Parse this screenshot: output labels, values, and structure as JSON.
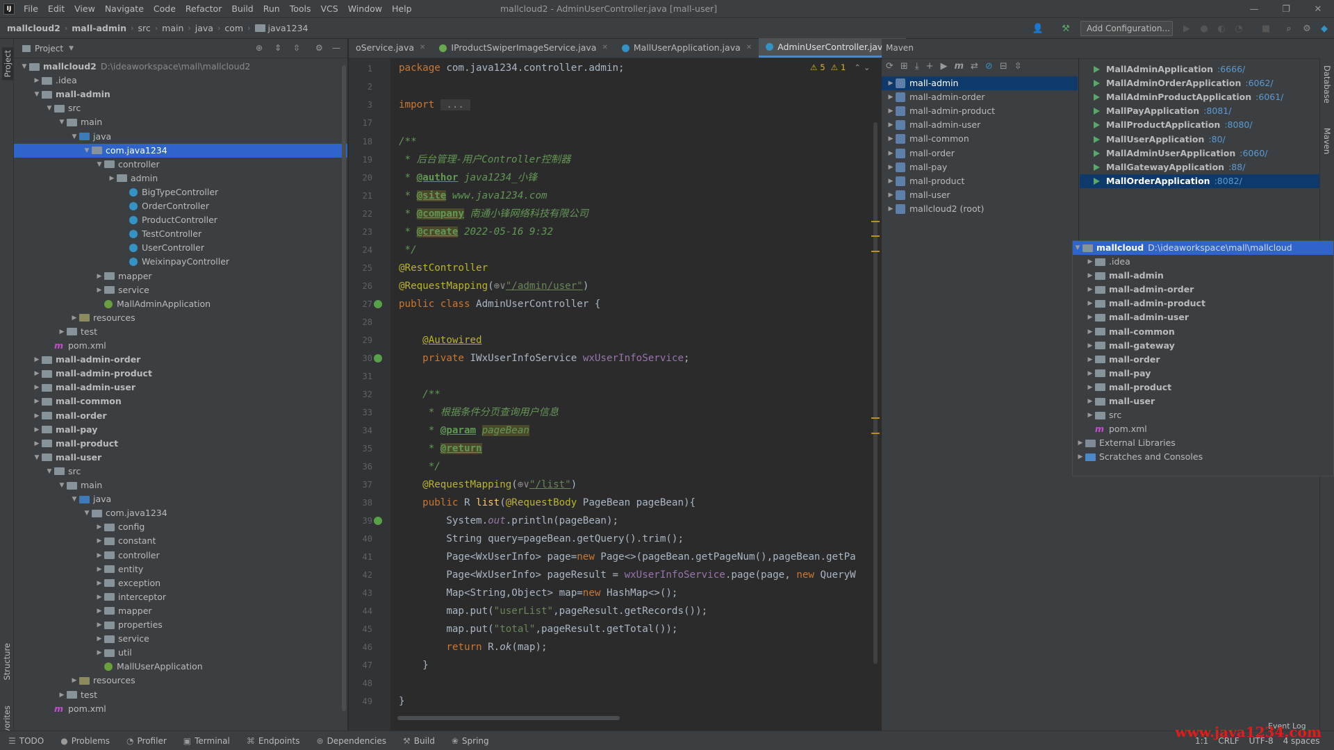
{
  "menu": {
    "items": [
      "File",
      "Edit",
      "View",
      "Navigate",
      "Code",
      "Refactor",
      "Build",
      "Run",
      "Tools",
      "VCS",
      "Window",
      "Help"
    ],
    "window_title": "mallcloud2 - AdminUserController.java [mall-user]"
  },
  "breadcrumb": [
    "mallcloud2",
    "mall-admin",
    "src",
    "main",
    "java",
    "com",
    "java1234"
  ],
  "toolbar": {
    "run_config": "Add Configuration..."
  },
  "side_labels": {
    "project": "Project",
    "structure": "Structure",
    "favorites": "Favorites",
    "database": "Database",
    "maven": "Maven"
  },
  "project": {
    "title": "Project",
    "tree": [
      {
        "label": "mallcloud2",
        "path": "D:\\ideaworkspace\\mall\\mallcloud2",
        "bold": true,
        "icon": "module",
        "indent": 0,
        "arrow": "open"
      },
      {
        "label": ".idea",
        "icon": "folder",
        "indent": 1,
        "arrow": "closed"
      },
      {
        "label": "mall-admin",
        "icon": "module",
        "indent": 1,
        "arrow": "open",
        "bold": true
      },
      {
        "label": "src",
        "icon": "folder",
        "indent": 2,
        "arrow": "open"
      },
      {
        "label": "main",
        "icon": "folder",
        "indent": 3,
        "arrow": "open"
      },
      {
        "label": "java",
        "icon": "src",
        "indent": 4,
        "arrow": "open"
      },
      {
        "label": "com.java1234",
        "icon": "folder",
        "indent": 5,
        "arrow": "open",
        "selected": true
      },
      {
        "label": "controller",
        "icon": "folder",
        "indent": 6,
        "arrow": "open"
      },
      {
        "label": "admin",
        "icon": "folder",
        "indent": 7,
        "arrow": "closed"
      },
      {
        "label": "BigTypeController",
        "icon": "class",
        "indent": 8
      },
      {
        "label": "OrderController",
        "icon": "class",
        "indent": 8
      },
      {
        "label": "ProductController",
        "icon": "class",
        "indent": 8
      },
      {
        "label": "TestController",
        "icon": "class",
        "indent": 8
      },
      {
        "label": "UserController",
        "icon": "class",
        "indent": 8
      },
      {
        "label": "WeixinpayController",
        "icon": "class",
        "indent": 8
      },
      {
        "label": "mapper",
        "icon": "folder",
        "indent": 6,
        "arrow": "closed"
      },
      {
        "label": "service",
        "icon": "folder",
        "indent": 6,
        "arrow": "closed"
      },
      {
        "label": "MallAdminApplication",
        "icon": "spring",
        "indent": 6
      },
      {
        "label": "resources",
        "icon": "res",
        "indent": 4,
        "arrow": "closed"
      },
      {
        "label": "test",
        "icon": "folder",
        "indent": 3,
        "arrow": "closed"
      },
      {
        "label": "pom.xml",
        "icon": "maven",
        "indent": 2
      },
      {
        "label": "mall-admin-order",
        "icon": "module",
        "indent": 1,
        "arrow": "closed",
        "bold": true
      },
      {
        "label": "mall-admin-product",
        "icon": "module",
        "indent": 1,
        "arrow": "closed",
        "bold": true
      },
      {
        "label": "mall-admin-user",
        "icon": "module",
        "indent": 1,
        "arrow": "closed",
        "bold": true
      },
      {
        "label": "mall-common",
        "icon": "module",
        "indent": 1,
        "arrow": "closed",
        "bold": true
      },
      {
        "label": "mall-order",
        "icon": "module",
        "indent": 1,
        "arrow": "closed",
        "bold": true
      },
      {
        "label": "mall-pay",
        "icon": "module",
        "indent": 1,
        "arrow": "closed",
        "bold": true
      },
      {
        "label": "mall-product",
        "icon": "module",
        "indent": 1,
        "arrow": "closed",
        "bold": true
      },
      {
        "label": "mall-user",
        "icon": "module",
        "indent": 1,
        "arrow": "open",
        "bold": true
      },
      {
        "label": "src",
        "icon": "folder",
        "indent": 2,
        "arrow": "open"
      },
      {
        "label": "main",
        "icon": "folder",
        "indent": 3,
        "arrow": "open"
      },
      {
        "label": "java",
        "icon": "src",
        "indent": 4,
        "arrow": "open"
      },
      {
        "label": "com.java1234",
        "icon": "folder",
        "indent": 5,
        "arrow": "open"
      },
      {
        "label": "config",
        "icon": "folder",
        "indent": 6,
        "arrow": "closed"
      },
      {
        "label": "constant",
        "icon": "folder",
        "indent": 6,
        "arrow": "closed"
      },
      {
        "label": "controller",
        "icon": "folder",
        "indent": 6,
        "arrow": "closed"
      },
      {
        "label": "entity",
        "icon": "folder",
        "indent": 6,
        "arrow": "closed"
      },
      {
        "label": "exception",
        "icon": "folder",
        "indent": 6,
        "arrow": "closed"
      },
      {
        "label": "interceptor",
        "icon": "folder",
        "indent": 6,
        "arrow": "closed"
      },
      {
        "label": "mapper",
        "icon": "folder",
        "indent": 6,
        "arrow": "closed"
      },
      {
        "label": "properties",
        "icon": "folder",
        "indent": 6,
        "arrow": "closed"
      },
      {
        "label": "service",
        "icon": "folder",
        "indent": 6,
        "arrow": "closed"
      },
      {
        "label": "util",
        "icon": "folder",
        "indent": 6,
        "arrow": "closed"
      },
      {
        "label": "MallUserApplication",
        "icon": "spring",
        "indent": 6
      },
      {
        "label": "resources",
        "icon": "res",
        "indent": 4,
        "arrow": "closed"
      },
      {
        "label": "test",
        "icon": "folder",
        "indent": 3,
        "arrow": "closed"
      },
      {
        "label": "pom.xml",
        "icon": "maven",
        "indent": 2
      }
    ]
  },
  "editor": {
    "tabs": [
      {
        "label": "oService.java",
        "active": false
      },
      {
        "label": "IProductSwiperImageService.java",
        "active": false
      },
      {
        "label": "MallUserApplication.java",
        "active": false
      },
      {
        "label": "AdminUserController.java",
        "active": true
      }
    ],
    "inspection": {
      "warnings": "5",
      "weak": "1"
    },
    "line_numbers": [
      "1",
      "2",
      "3",
      "17",
      "18",
      "19",
      "20",
      "21",
      "22",
      "23",
      "24",
      "25",
      "26",
      "27",
      "28",
      "29",
      "30",
      "31",
      "32",
      "33",
      "34",
      "35",
      "36",
      "37",
      "38",
      "39",
      "40",
      "41",
      "42",
      "43",
      "44",
      "45",
      "46",
      "47",
      "48",
      "49"
    ]
  },
  "maven": {
    "title": "Maven",
    "modules": [
      "mall-admin",
      "mall-admin-order",
      "mall-admin-product",
      "mall-admin-user",
      "mall-common",
      "mall-order",
      "mall-pay",
      "mall-product",
      "mall-user",
      "mallcloud2 (root)"
    ],
    "apps": [
      {
        "name": "MallAdminApplication",
        "port": ":6666/"
      },
      {
        "name": "MallAdminOrderApplication",
        "port": ":6062/"
      },
      {
        "name": "MallAdminProductApplication",
        "port": ":6061/"
      },
      {
        "name": "MallPayApplication",
        "port": ":8081/"
      },
      {
        "name": "MallProductApplication",
        "port": ":8080/"
      },
      {
        "name": "MallUserApplication",
        "port": ":80/"
      },
      {
        "name": "MallAdminUserApplication",
        "port": ":6060/"
      },
      {
        "name": "MallGatewayApplication",
        "port": ":88/"
      },
      {
        "name": "MallOrderApplication",
        "port": ":8082/"
      }
    ]
  },
  "popup_tree": {
    "root": "mallcloud",
    "root_path": "D:\\ideaworkspace\\mall\\mallcloud",
    "items": [
      ".idea",
      "mall-admin",
      "mall-admin-order",
      "mall-admin-product",
      "mall-admin-user",
      "mall-common",
      "mall-gateway",
      "mall-order",
      "mall-pay",
      "mall-product",
      "mall-user",
      "src",
      "pom.xml",
      "External Libraries",
      "Scratches and Consoles"
    ]
  },
  "statusbar": {
    "items": [
      "TODO",
      "Problems",
      "Profiler",
      "Terminal",
      "Endpoints",
      "Dependencies",
      "Build",
      "Spring"
    ],
    "position": "1:1",
    "line_sep": "CRLF",
    "encoding": "UTF-8",
    "indent": "4 spaces",
    "event_log": "Event Log",
    "watermark": "www.java1234.com"
  },
  "colors": {
    "selection": "#2f65ca",
    "bg": "#2b2b2b",
    "panel": "#3c3f41",
    "keyword": "#cc7832",
    "annotation": "#bbb529",
    "string": "#6a8759"
  }
}
